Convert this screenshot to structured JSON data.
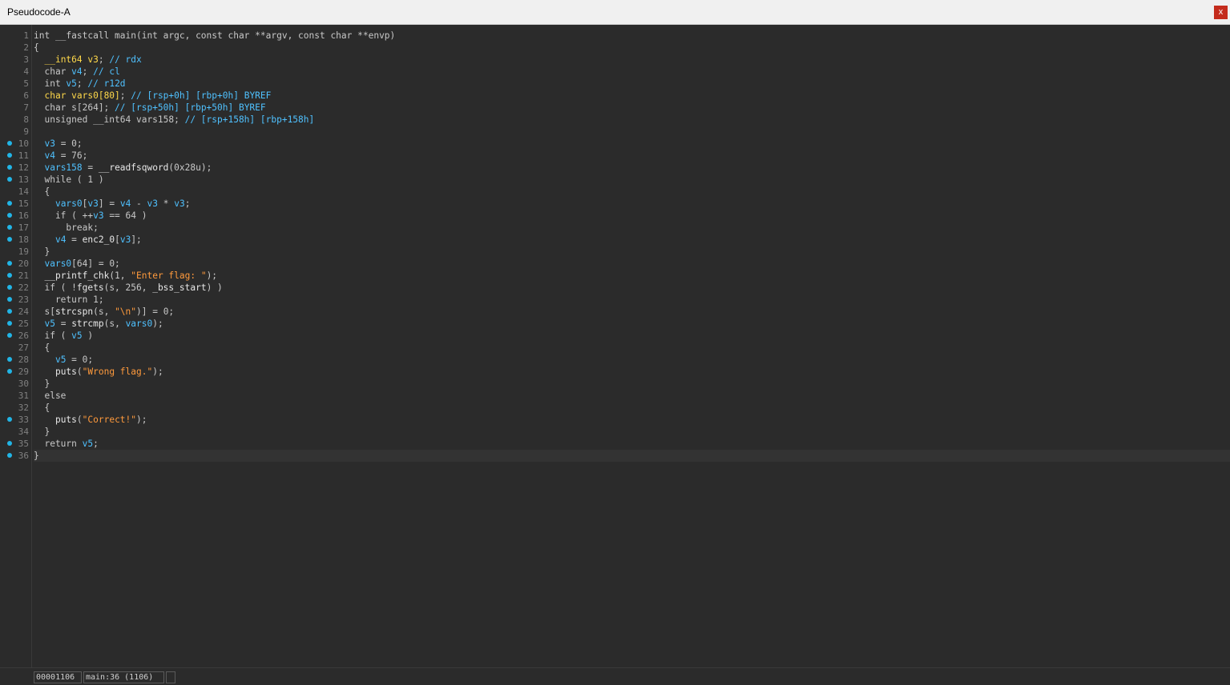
{
  "window": {
    "title": "Pseudocode-A",
    "close_label": "x"
  },
  "colors": {
    "background": "#2b2b2b",
    "breakpoint_dot": "#21b5e6",
    "string": "#ff9a3c",
    "variable": "#4fc1ff",
    "global": "#ffd94a"
  },
  "code_lines": [
    {
      "num": "1",
      "dot": false,
      "tokens": [
        [
          "k",
          "int __fastcall main(int argc, const char **argv, const char **envp)"
        ]
      ]
    },
    {
      "num": "2",
      "dot": false,
      "tokens": [
        [
          "k",
          "{"
        ]
      ]
    },
    {
      "num": "3",
      "dot": false,
      "tokens": [
        [
          "k",
          "  "
        ],
        [
          "gl",
          "__int64 v3"
        ],
        [
          "k",
          "; "
        ],
        [
          "cmt",
          "// rdx"
        ]
      ]
    },
    {
      "num": "4",
      "dot": false,
      "tokens": [
        [
          "k",
          "  char "
        ],
        [
          "var",
          "v4"
        ],
        [
          "k",
          "; "
        ],
        [
          "cmt",
          "// cl"
        ]
      ]
    },
    {
      "num": "5",
      "dot": false,
      "tokens": [
        [
          "k",
          "  int "
        ],
        [
          "var",
          "v5"
        ],
        [
          "k",
          "; "
        ],
        [
          "cmt",
          "// r12d"
        ]
      ]
    },
    {
      "num": "6",
      "dot": false,
      "tokens": [
        [
          "k",
          "  "
        ],
        [
          "gl",
          "char vars0[80]"
        ],
        [
          "k",
          "; "
        ],
        [
          "cmt",
          "// [rsp+0h] [rbp+0h] BYREF"
        ]
      ]
    },
    {
      "num": "7",
      "dot": false,
      "tokens": [
        [
          "k",
          "  char s[264]; "
        ],
        [
          "cmt",
          "// [rsp+50h] [rbp+50h] BYREF"
        ]
      ]
    },
    {
      "num": "8",
      "dot": false,
      "tokens": [
        [
          "k",
          "  unsigned __int64 vars158; "
        ],
        [
          "cmt",
          "// [rsp+158h] [rbp+158h]"
        ]
      ]
    },
    {
      "num": "9",
      "dot": false,
      "tokens": []
    },
    {
      "num": "10",
      "dot": true,
      "tokens": [
        [
          "k",
          "  "
        ],
        [
          "var",
          "v3"
        ],
        [
          "k",
          " = 0;"
        ]
      ]
    },
    {
      "num": "11",
      "dot": true,
      "tokens": [
        [
          "k",
          "  "
        ],
        [
          "var",
          "v4"
        ],
        [
          "k",
          " = 76;"
        ]
      ]
    },
    {
      "num": "12",
      "dot": true,
      "tokens": [
        [
          "k",
          "  "
        ],
        [
          "var",
          "vars158"
        ],
        [
          "k",
          " = "
        ],
        [
          "fn",
          "__readfsqword"
        ],
        [
          "k",
          "(0x28u);"
        ]
      ]
    },
    {
      "num": "13",
      "dot": true,
      "tokens": [
        [
          "k",
          "  while ( 1 )"
        ]
      ]
    },
    {
      "num": "14",
      "dot": false,
      "tokens": [
        [
          "k",
          "  {"
        ]
      ]
    },
    {
      "num": "15",
      "dot": true,
      "tokens": [
        [
          "k",
          "    "
        ],
        [
          "var",
          "vars0"
        ],
        [
          "k",
          "["
        ],
        [
          "var",
          "v3"
        ],
        [
          "k",
          "] = "
        ],
        [
          "var",
          "v4"
        ],
        [
          "k",
          " - "
        ],
        [
          "var",
          "v3"
        ],
        [
          "k",
          " * "
        ],
        [
          "var",
          "v3"
        ],
        [
          "k",
          ";"
        ]
      ]
    },
    {
      "num": "16",
      "dot": true,
      "tokens": [
        [
          "k",
          "    if ( ++"
        ],
        [
          "var",
          "v3"
        ],
        [
          "k",
          " == 64 )"
        ]
      ]
    },
    {
      "num": "17",
      "dot": true,
      "tokens": [
        [
          "k",
          "      break;"
        ]
      ]
    },
    {
      "num": "18",
      "dot": true,
      "tokens": [
        [
          "k",
          "    "
        ],
        [
          "var",
          "v4"
        ],
        [
          "k",
          " = "
        ],
        [
          "fn",
          "enc2_0"
        ],
        [
          "k",
          "["
        ],
        [
          "var",
          "v3"
        ],
        [
          "k",
          "];"
        ]
      ]
    },
    {
      "num": "19",
      "dot": false,
      "tokens": [
        [
          "k",
          "  }"
        ]
      ]
    },
    {
      "num": "20",
      "dot": true,
      "tokens": [
        [
          "k",
          "  "
        ],
        [
          "var",
          "vars0"
        ],
        [
          "k",
          "[64] = 0;"
        ]
      ]
    },
    {
      "num": "21",
      "dot": true,
      "tokens": [
        [
          "k",
          "  "
        ],
        [
          "fn",
          "__printf_chk"
        ],
        [
          "k",
          "(1, "
        ],
        [
          "str",
          "\"Enter flag: \""
        ],
        [
          "k",
          ");"
        ]
      ]
    },
    {
      "num": "22",
      "dot": true,
      "tokens": [
        [
          "k",
          "  if ( !"
        ],
        [
          "fn",
          "fgets"
        ],
        [
          "k",
          "(s, 256, "
        ],
        [
          "fn",
          "_bss_start"
        ],
        [
          "k",
          ") )"
        ]
      ]
    },
    {
      "num": "23",
      "dot": true,
      "tokens": [
        [
          "k",
          "    return 1;"
        ]
      ]
    },
    {
      "num": "24",
      "dot": true,
      "tokens": [
        [
          "k",
          "  s["
        ],
        [
          "fn",
          "strcspn"
        ],
        [
          "k",
          "(s, "
        ],
        [
          "str",
          "\"\\n\""
        ],
        [
          "k",
          ")] = 0;"
        ]
      ]
    },
    {
      "num": "25",
      "dot": true,
      "tokens": [
        [
          "k",
          "  "
        ],
        [
          "var",
          "v5"
        ],
        [
          "k",
          " = "
        ],
        [
          "fn",
          "strcmp"
        ],
        [
          "k",
          "(s, "
        ],
        [
          "var",
          "vars0"
        ],
        [
          "k",
          ");"
        ]
      ]
    },
    {
      "num": "26",
      "dot": true,
      "tokens": [
        [
          "k",
          "  if ( "
        ],
        [
          "var",
          "v5"
        ],
        [
          "k",
          " )"
        ]
      ]
    },
    {
      "num": "27",
      "dot": false,
      "tokens": [
        [
          "k",
          "  {"
        ]
      ]
    },
    {
      "num": "28",
      "dot": true,
      "tokens": [
        [
          "k",
          "    "
        ],
        [
          "var",
          "v5"
        ],
        [
          "k",
          " = 0;"
        ]
      ]
    },
    {
      "num": "29",
      "dot": true,
      "tokens": [
        [
          "k",
          "    "
        ],
        [
          "fn",
          "puts"
        ],
        [
          "k",
          "("
        ],
        [
          "str",
          "\"Wrong flag.\""
        ],
        [
          "k",
          ");"
        ]
      ]
    },
    {
      "num": "30",
      "dot": false,
      "tokens": [
        [
          "k",
          "  }"
        ]
      ]
    },
    {
      "num": "31",
      "dot": false,
      "tokens": [
        [
          "k",
          "  else"
        ]
      ]
    },
    {
      "num": "32",
      "dot": false,
      "tokens": [
        [
          "k",
          "  {"
        ]
      ]
    },
    {
      "num": "33",
      "dot": true,
      "tokens": [
        [
          "k",
          "    "
        ],
        [
          "fn",
          "puts"
        ],
        [
          "k",
          "("
        ],
        [
          "str",
          "\"Correct!\""
        ],
        [
          "k",
          ");"
        ]
      ]
    },
    {
      "num": "34",
      "dot": false,
      "tokens": [
        [
          "k",
          "  }"
        ]
      ]
    },
    {
      "num": "35",
      "dot": true,
      "tokens": [
        [
          "k",
          "  return "
        ],
        [
          "var",
          "v5"
        ],
        [
          "k",
          ";"
        ]
      ]
    },
    {
      "num": "36",
      "dot": true,
      "tokens": [
        [
          "k",
          "}"
        ]
      ],
      "current": true
    }
  ],
  "status": {
    "address": "00001106",
    "location": "main:36 (1106)"
  }
}
